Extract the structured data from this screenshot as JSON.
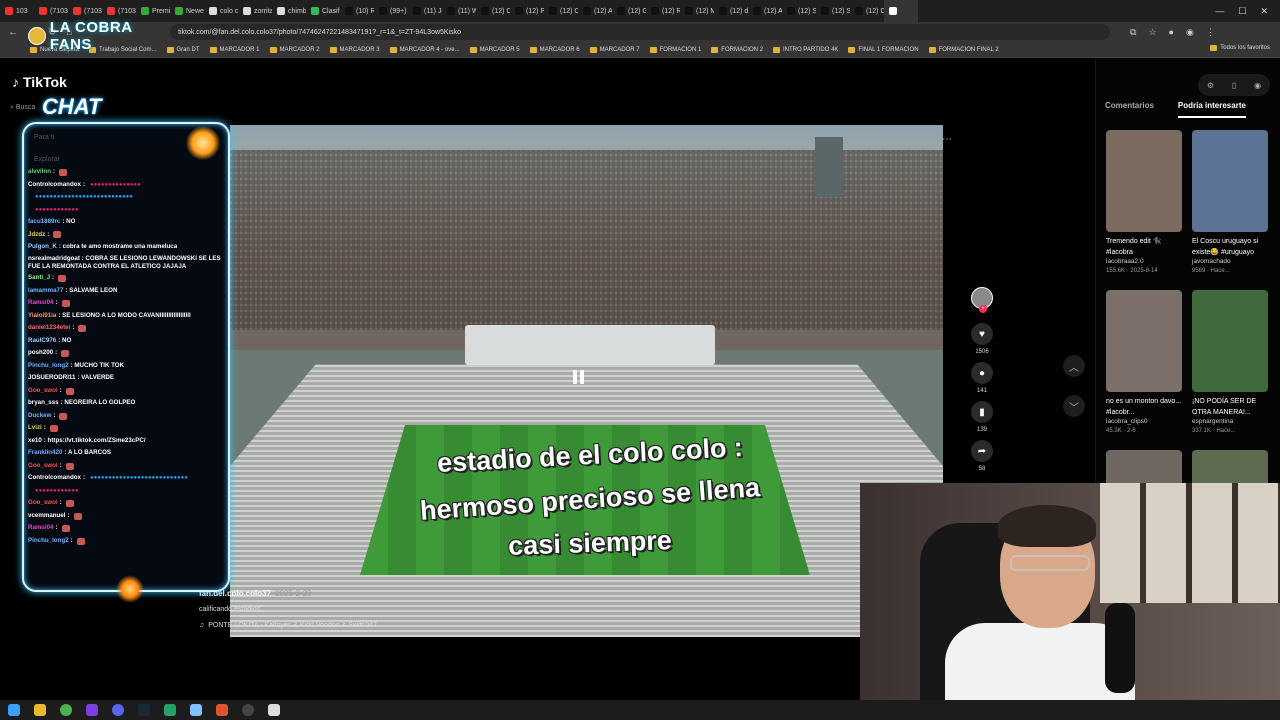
{
  "browser": {
    "tabs": [
      {
        "label": "103",
        "color": "#e33"
      },
      {
        "label": "(7103)",
        "color": "#e33"
      },
      {
        "label": "(7103)",
        "color": "#e33"
      },
      {
        "label": "(7103)",
        "color": "#e33"
      },
      {
        "label": "Premi",
        "color": "#3a3"
      },
      {
        "label": "Newell",
        "color": "#3a3"
      },
      {
        "label": "colo cc",
        "color": "#ddd"
      },
      {
        "label": "zorrita",
        "color": "#ddd"
      },
      {
        "label": "chimb",
        "color": "#ddd"
      },
      {
        "label": "Clasifi",
        "color": "#3b5"
      },
      {
        "label": "(10) R",
        "color": "#111"
      },
      {
        "label": "(99+) Y",
        "color": "#111"
      },
      {
        "label": "(11) Je",
        "color": "#111"
      },
      {
        "label": "(11) W",
        "color": "#111"
      },
      {
        "label": "(12) C",
        "color": "#111"
      },
      {
        "label": "(12) P",
        "color": "#111"
      },
      {
        "label": "(12) C",
        "color": "#111"
      },
      {
        "label": "(12) A",
        "color": "#111"
      },
      {
        "label": "(12) G",
        "color": "#111"
      },
      {
        "label": "(12) R",
        "color": "#111"
      },
      {
        "label": "(12) M",
        "color": "#111"
      },
      {
        "label": "(12) de",
        "color": "#111"
      },
      {
        "label": "(12) A",
        "color": "#111"
      },
      {
        "label": "(12) Sp",
        "color": "#111"
      },
      {
        "label": "(12) Sp",
        "color": "#111"
      },
      {
        "label": "(12) C",
        "color": "#111"
      },
      {
        "label": "",
        "color": "#fff"
      }
    ],
    "url": "tiktok.com/@fan.del.colo.colo37/photo/7474624722148347191?_r=1&_t=ZT-94L3ow5Kisko",
    "bookmarks": [
      "Nueva carpeta",
      "Trabajo Social Com...",
      "Gran DT",
      "MARCADOR 1",
      "MARCADOR 2",
      "MARCADOR 3",
      "MARCADOR 4 - ove...",
      "MARCADOR 5",
      "MARCADOR 6",
      "MARCADOR 7",
      "FORMACION 1",
      "FORMACION 2",
      "INTRO PARTIDO 4K",
      "FINAL 1 FORMACION",
      "FORMACION FINAL 2"
    ],
    "all_bookmarks": "Todos los favoritos"
  },
  "overlay": {
    "brand": "LA COBRA FANS",
    "chat_title": "CHAT",
    "faint_for_you": "Para ti",
    "faint_explore": "Explorar",
    "chat_messages": [
      {
        "user": "alvvilnn",
        "text": ":",
        "color": "#6bd36b",
        "emoji": true
      },
      {
        "user": "Controlcomandox",
        "text": ":",
        "color": "#ffffff",
        "dots": "●●●●●●●●●●●●●●"
      },
      {
        "user": "",
        "text": "",
        "color": "#fff",
        "dots": "●●●●●●●●●●●●●●●●●●●●●●●●●●●"
      },
      {
        "user": "",
        "text": "",
        "color": "#fff",
        "dots": "●●●●●●●●●●●●"
      },
      {
        "user": "facu1889rc",
        "text": ": NO",
        "color": "#6fb6ff"
      },
      {
        "user": "Jdzdz",
        "text": ":",
        "color": "#e6d24f",
        "emoji": true
      },
      {
        "user": "Pulgon_K",
        "text": ": cobra te amo mostrame una mameluca",
        "color": "#9ad0ff"
      },
      {
        "user": "nsrealmadridgoat",
        "text": ": COBRA SE LESIONO LEWANDOWSKI SE LES FUE LA REMONTADA CONTRA EL ATLETICO JAJAJA",
        "color": "#ffffff",
        "wrap": true
      },
      {
        "user": "Santi_J",
        "text": ":",
        "color": "#8ef08e",
        "emoji": true
      },
      {
        "user": "lamamma77",
        "text": ": SALVAME LEON",
        "color": "#6fb6ff"
      },
      {
        "user": "Ramsi04",
        "text": ":",
        "color": "#e24cc2",
        "emoji": true
      },
      {
        "user": "Yiaioi91ia",
        "text": ": SE LESIONO A LO MODO CAVANIIIIIIIIIIIIIIIIII",
        "color": "#ff9a5c"
      },
      {
        "user": "daniel1234etei",
        "text": ":",
        "color": "#ff6b6b",
        "emoji": true
      },
      {
        "user": "RaulC976",
        "text": ": NO",
        "color": "#9ad0ff"
      },
      {
        "user": "posh200",
        "text": ":",
        "color": "#ffffff",
        "emoji": true
      },
      {
        "user": "Pinchu_long2",
        "text": ": MUCHO TIK TOK",
        "color": "#6fb6ff"
      },
      {
        "user": "JOSUERODRI11",
        "text": ": VALVERDE",
        "color": "#ffffff"
      },
      {
        "user": "Goo_swoi",
        "text": ":",
        "color": "#ff4f4f",
        "emoji": true
      },
      {
        "user": "bryan_sss",
        "text": ": NEGREIRA LO GOLPEO",
        "color": "#ffffff"
      },
      {
        "user": "Duckew",
        "text": ":",
        "color": "#6fb6ff",
        "emoji": true
      },
      {
        "user": "Lvizi",
        "text": ":",
        "color": "#e6d24f",
        "emoji": true
      },
      {
        "user": "xe10",
        "text": ": https://vt.tiktok.com/ZSme23cPC/",
        "color": "#ffffff"
      },
      {
        "user": "Franklin420",
        "text": ": A LO BARCOS",
        "color": "#6fb6ff"
      },
      {
        "user": "Goo_swoi",
        "text": ":",
        "color": "#ff4f4f",
        "emoji": true
      },
      {
        "user": "Controlcomandox",
        "text": ":",
        "color": "#ffffff",
        "dots": "●●●●●●●●●●●●●●●●●●●●●●●●●●●"
      },
      {
        "user": "",
        "text": "",
        "color": "#fff",
        "dots": "●●●●●●●●●●●●"
      },
      {
        "user": "Goo_swoi",
        "text": ":",
        "color": "#ff4f4f",
        "emoji": true
      },
      {
        "user": "vcemmanuel",
        "text": ":",
        "color": "#ffffff",
        "emoji": true
      },
      {
        "user": "Ramsi04",
        "text": ":",
        "color": "#e24cc2",
        "emoji": true
      },
      {
        "user": "Pinchu_long2",
        "text": ":",
        "color": "#6fb6ff",
        "emoji": true
      }
    ]
  },
  "tiktok": {
    "logo": "TikTok",
    "search_short": "Busca",
    "caption_lines": [
      "estadio de el colo colo :",
      "hermoso precioso se llena",
      "casi siempre"
    ],
    "author": "fan.del.colo.colo37",
    "date": "2025-2-23",
    "description": "calificando estadios",
    "music": "PONTE LOKITA - Kaltoyes & Kidd Voodoo & Swift 047",
    "likes": "1506",
    "comments": "141",
    "saves": "139",
    "shares": "58",
    "tabs": {
      "comments": "Comentarios",
      "recommended": "Podría interesarte"
    },
    "cards": [
      {
        "title": "Tremendo edit 🐈‍⬛ #lacobra",
        "author": "lacobraaa2.0",
        "stats": "155.6K · 2025-8-14",
        "color": "#7a6a60"
      },
      {
        "title": "El Coscu uruguayo si existe😂 #uruguayo",
        "author": "javomachado",
        "stats": "9569 · Hace...",
        "color": "#5c7396"
      },
      {
        "title": "no es un monton davo... #lacobr...",
        "author": "lacobra_clips0",
        "stats": "45.3K · 2-6",
        "color": "#7c6f6a"
      },
      {
        "title": "¡NO PODÍA SER DE OTRA MANERA!...",
        "author": "espnargentina",
        "stats": "337.1K · Hace...",
        "color": "#3f6a3d"
      },
      {
        "title": "",
        "author": "",
        "stats": "",
        "color": "#6d6661"
      },
      {
        "title": "",
        "author": "",
        "stats": "",
        "color": "#5d6b50"
      }
    ]
  }
}
